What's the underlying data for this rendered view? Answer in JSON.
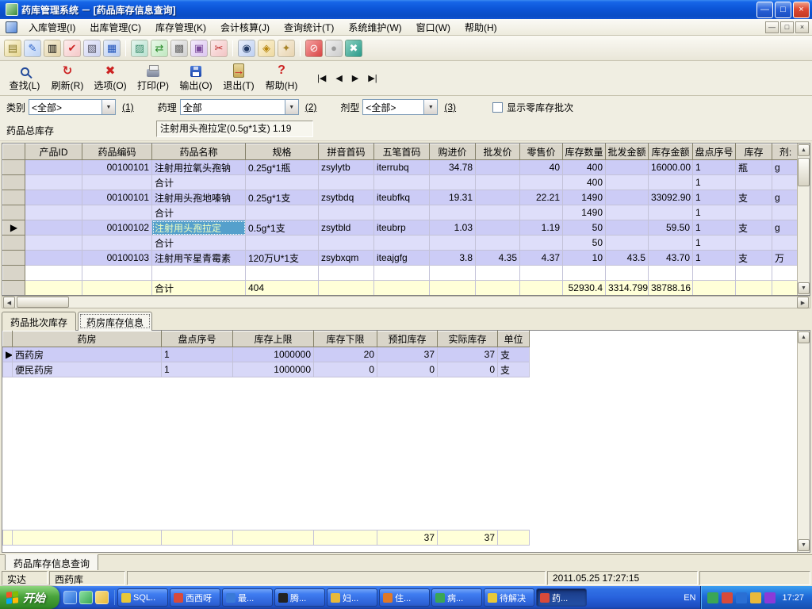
{
  "glyphs": {
    "min": "—",
    "max": "□",
    "close": "×",
    "left": "◀",
    "right": "▶",
    "up": "▲",
    "down": "▼"
  },
  "window": {
    "title": "药库管理系统 － [药品库存信息查询]"
  },
  "menubar": {
    "items": [
      "入库管理(I)",
      "出库管理(C)",
      "库存管理(K)",
      "会计核算(J)",
      "查询统计(T)",
      "系统维护(W)",
      "窗口(W)",
      "帮助(H)"
    ]
  },
  "action_bar": {
    "buttons": [
      {
        "label": "查找(L)"
      },
      {
        "label": "刷新(R)"
      },
      {
        "label": "选项(O)"
      },
      {
        "label": "打印(P)"
      },
      {
        "label": "输出(O)"
      },
      {
        "label": "退出(T)"
      },
      {
        "label": "帮助(H)"
      }
    ],
    "nav": [
      "|◀",
      "◀",
      "▶",
      "▶|"
    ]
  },
  "filters": {
    "category": {
      "label": "类别",
      "value": "<全部>",
      "hint": "(1)"
    },
    "pharmacology": {
      "label": "药理",
      "value": "全部",
      "hint": "(2)"
    },
    "dosage_form": {
      "label": "剂型",
      "value": "<全部>",
      "hint": "(3)"
    },
    "show_zero_stock": {
      "label": "显示零库存批次",
      "checked": false
    }
  },
  "summary": {
    "label": "药品总库存",
    "value": "注射用头孢拉定(0.5g*1支) 1.19"
  },
  "main_table": {
    "headers": [
      "",
      "产品ID",
      "药品编码",
      "药品名称",
      "规格",
      "拼音首码",
      "五笔首码",
      "购进价",
      "批发价",
      "零售价",
      "库存数量",
      "批发金额",
      "库存金额",
      "盘点序号",
      "库存",
      "剂:"
    ],
    "rows": [
      {
        "type": "data",
        "cells": [
          "",
          "",
          "00100101",
          "注射用拉氧头孢钠",
          "0.25g*1瓶",
          "zsylytb",
          "iterrubq",
          "34.78",
          "",
          "40",
          "400",
          "",
          "16000.00",
          "1",
          "瓶",
          "g"
        ]
      },
      {
        "type": "subtotal",
        "cells": [
          "",
          "",
          "",
          "合计",
          "",
          "",
          "",
          "",
          "",
          "",
          "400",
          "",
          "",
          "1",
          "",
          ""
        ]
      },
      {
        "type": "data",
        "cells": [
          "",
          "",
          "00100101",
          "注射用头孢地嗪钠",
          "0.25g*1支",
          "zsytbdq",
          "iteubfkq",
          "19.31",
          "",
          "22.21",
          "1490",
          "",
          "33092.90",
          "1",
          "支",
          "g"
        ]
      },
      {
        "type": "subtotal",
        "cells": [
          "",
          "",
          "",
          "合计",
          "",
          "",
          "",
          "",
          "",
          "",
          "1490",
          "",
          "",
          "1",
          "",
          ""
        ]
      },
      {
        "type": "data",
        "highlight": 3,
        "cells": [
          "▶",
          "",
          "00100102",
          "注射用头孢拉定",
          "0.5g*1支",
          "zsytbld",
          "iteubrp",
          "1.03",
          "",
          "1.19",
          "50",
          "",
          "59.50",
          "1",
          "支",
          "g"
        ]
      },
      {
        "type": "subtotal",
        "cells": [
          "",
          "",
          "",
          "合计",
          "",
          "",
          "",
          "",
          "",
          "",
          "50",
          "",
          "",
          "1",
          "",
          ""
        ]
      },
      {
        "type": "data",
        "cells": [
          "",
          "",
          "00100103",
          "注射用苄星青霉素",
          "120万U*1支",
          "zsybxqm",
          "iteajgfg",
          "3.8",
          "4.35",
          "4.37",
          "10",
          "43.5",
          "43.70",
          "1",
          "支",
          "万"
        ]
      },
      {
        "type": "empty",
        "cells": [
          "",
          "",
          "",
          "",
          "",
          "",
          "",
          "",
          "",
          "",
          "",
          "",
          "",
          "",
          "",
          ""
        ]
      },
      {
        "type": "total",
        "cells": [
          "",
          "",
          "",
          "合计",
          "404",
          "",
          "",
          "",
          "",
          "",
          "52930.4",
          "3314.799",
          "38788.16",
          "",
          "",
          ""
        ]
      }
    ]
  },
  "tabs": {
    "items": [
      "药品批次库存",
      "药房库存信息"
    ],
    "active_index": 1
  },
  "detail_table": {
    "headers": [
      "",
      "药房",
      "盘点序号",
      "库存上限",
      "库存下限",
      "预扣库存",
      "实际库存",
      "单位"
    ],
    "rows": [
      {
        "type": "data",
        "cells": [
          "▶",
          "西药房",
          "1",
          "1000000",
          "20",
          "37",
          "37",
          "支"
        ]
      },
      {
        "type": "data",
        "cells": [
          "",
          "便民药房",
          "1",
          "1000000",
          "0",
          "0",
          "0",
          "支"
        ]
      }
    ]
  },
  "detail_footer": {
    "rows": [
      {
        "type": "total",
        "cells": [
          "",
          "",
          "",
          "",
          "",
          "37",
          "37",
          ""
        ]
      }
    ]
  },
  "bottom_tab": {
    "label": "药品库存信息查询"
  },
  "statusbar": {
    "panels": [
      "实达",
      "西药库",
      "",
      "2011.05.25 17:27:15",
      ""
    ]
  },
  "taskbar": {
    "start_label": "开始",
    "tasks": [
      "SQL..",
      "西西呀",
      "最...",
      "腾...",
      "妇...",
      "住...",
      "病...",
      "待解决",
      "药..."
    ],
    "active_task_index": 8,
    "language": "EN",
    "time": "17:27"
  },
  "colors": {
    "titlebar_blue": "#0c55d8",
    "row_lavender": "#ccccf6",
    "row_subtotal": "#dedefa",
    "row_total_cream": "#ffffd8",
    "selected_cell": "#55a0cc",
    "taskbar_blue": "#2862dc",
    "start_green": "#48a43c"
  }
}
